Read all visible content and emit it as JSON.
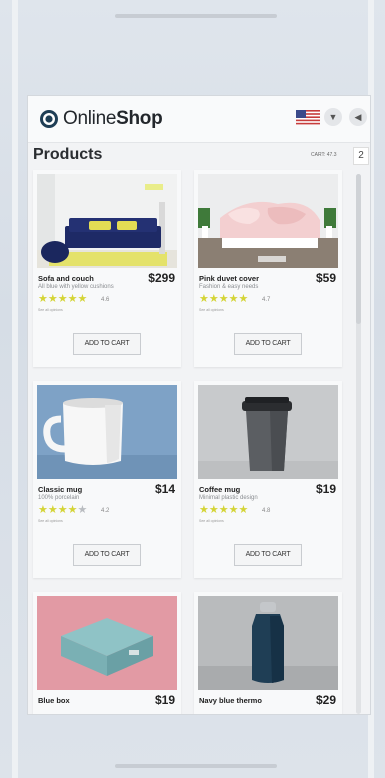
{
  "app": {
    "brand_prefix": "Online",
    "brand_suffix": "Shop",
    "page_title": "Products",
    "cart_label": "CART: 47.3",
    "cart_count": "2"
  },
  "colors": {
    "star": "#d4d436",
    "star_empty": "#b9bcc0",
    "accent_dark": "#1f3e55"
  },
  "products": [
    {
      "name": "Sofa and couch",
      "price": "$299",
      "desc": "All blue with yellow cushions",
      "rating": "4.6",
      "stars": 5,
      "review_label": "See all opinions",
      "button": "ADD TO CART"
    },
    {
      "name": "Pink duvet cover",
      "price": "$59",
      "desc": "Fashion & easy needs",
      "rating": "4.7",
      "stars": 5,
      "review_label": "See all opinions",
      "button": "ADD TO CART"
    },
    {
      "name": "Classic mug",
      "price": "$14",
      "desc": "100% porcelain",
      "rating": "4.2",
      "stars": 4,
      "review_label": "See all opinions",
      "button": "ADD TO CART"
    },
    {
      "name": "Coffee mug",
      "price": "$19",
      "desc": "Minimal plastic design",
      "rating": "4.8",
      "stars": 5,
      "review_label": "See all opinions",
      "button": "ADD TO CART"
    },
    {
      "name": "Blue box",
      "price": "$19"
    },
    {
      "name": "Navy blue thermo",
      "price": "$29"
    }
  ]
}
